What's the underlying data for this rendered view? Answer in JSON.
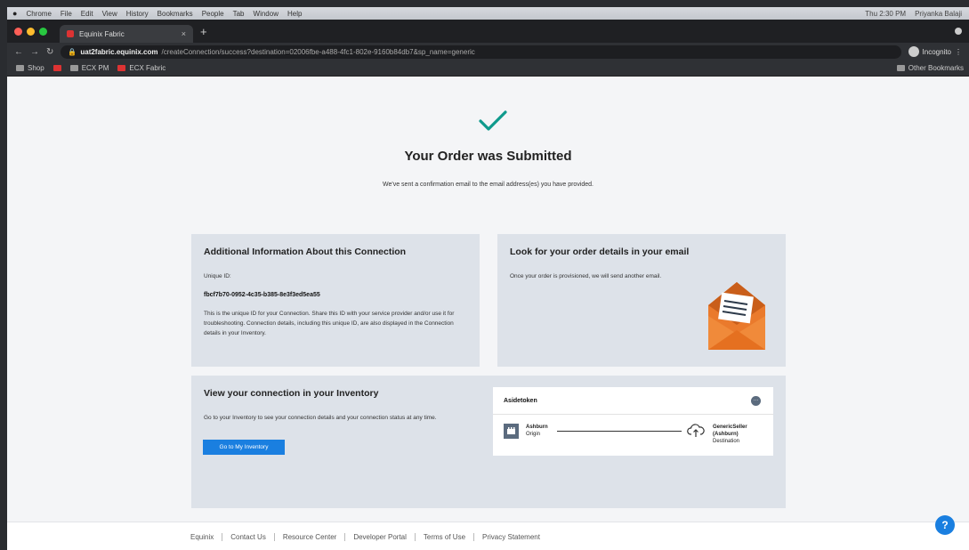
{
  "browser": {
    "menubar": {
      "apple": "",
      "items": [
        "Chrome",
        "File",
        "Edit",
        "View",
        "History",
        "Bookmarks",
        "People",
        "Tab",
        "Window",
        "Help"
      ],
      "clock": "Thu 2:30 PM",
      "user": "Priyanka Balaji"
    },
    "tab": {
      "title": "Equinix Fabric"
    },
    "url": {
      "host": "uat2fabric.equinix.com",
      "path": "/createConnection/success?destination=02006fbe-a488-4fc1-802e-9160b84db7&sp_name=generic"
    },
    "profile": "Incognito",
    "bookmarks": [
      "Shop",
      "",
      "ECX PM",
      "ECX Fabric"
    ],
    "other_bookmarks": "Other Bookmarks"
  },
  "page": {
    "title": "Your Order was Submitted",
    "subtitle": "We've sent a confirmation email to the email address(es) you have provided."
  },
  "additional_info": {
    "heading": "Additional Information About this Connection",
    "uid_label": "Unique ID:",
    "uid_value": "fbcf7b70-0952-4c35-b385-8e3f3ed5ea55",
    "description": "This is the unique ID for your Connection. Share this ID with your service provider and/or use it for troubleshooting. Connection details, including this unique ID, are also displayed in the Connection details in your Inventory."
  },
  "email_card": {
    "heading": "Look for your order details in your email",
    "text": "Once your order is provisioned, we will send another email."
  },
  "inventory": {
    "heading": "View your connection in your Inventory",
    "text": "Go to your Inventory to see your connection details and your connection status at any time.",
    "button": "Go to My Inventory"
  },
  "connection": {
    "name": "Asidetoken",
    "more": "···",
    "origin_name": "Ashburn",
    "origin_role": "Origin",
    "dest_name_1": "GenericSeller",
    "dest_name_2": "(Ashburn)",
    "dest_role": "Destination"
  },
  "footer": [
    "Equinix",
    "Contact Us",
    "Resource Center",
    "Developer Portal",
    "Terms of Use",
    "Privacy Statement"
  ],
  "help": "?",
  "colors": {
    "accent": "#1a7fe0",
    "check": "#0e9a8c",
    "envelope": "#ea7a2c"
  }
}
